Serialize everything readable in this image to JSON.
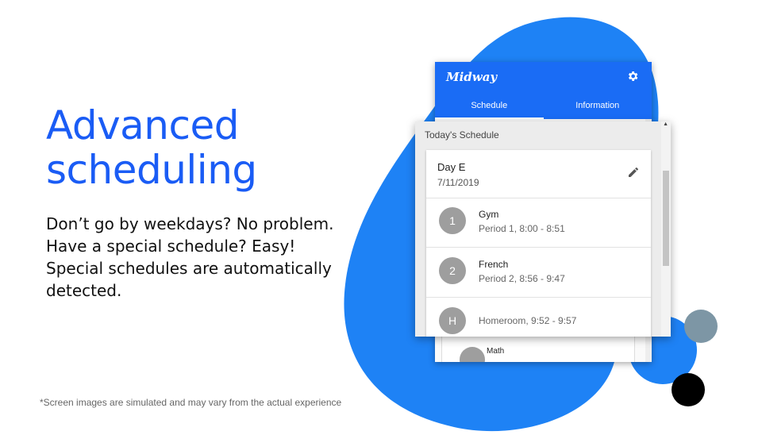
{
  "slide": {
    "title_line1": "Advanced",
    "title_line2": "scheduling",
    "body": "Don’t go by weekdays? No problem. Have a special schedule? Easy! Special schedules are automatically detected.",
    "disclaimer": "*Screen images are simulated and may vary from the actual experience"
  },
  "colors": {
    "accent": "#1a5cf5",
    "blob": "#1e82f5",
    "app_header": "#1a6cf5",
    "avatar": "#9e9e9e"
  },
  "app": {
    "logo": "Midway",
    "tabs": [
      "Schedule",
      "Information"
    ],
    "active_tab": "Schedule",
    "back_item_label": "Math",
    "icons": {
      "settings": "gear-icon",
      "edit": "pencil-icon"
    }
  },
  "schedule": {
    "heading": "Today's Schedule",
    "day": "Day E",
    "date": "7/11/2019",
    "periods": [
      {
        "badge": "1",
        "name": "Gym",
        "time": "Period 1, 8:00 - 8:51"
      },
      {
        "badge": "2",
        "name": "French",
        "time": "Period 2, 8:56 - 9:47"
      },
      {
        "badge": "H",
        "name": "",
        "time": "Homeroom, 9:52 - 9:57"
      }
    ]
  }
}
